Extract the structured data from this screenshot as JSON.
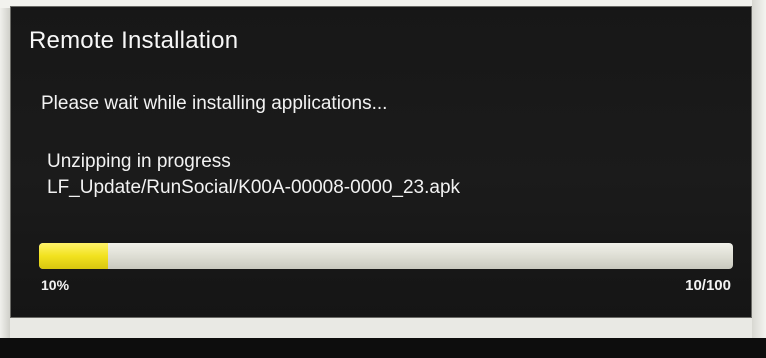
{
  "dialog": {
    "title": "Remote Installation",
    "message": "Please wait while installing applications...",
    "status": "Unzipping in progress",
    "file": "LF_Update/RunSocial/K00A-00008-0000_23.apk",
    "progress": {
      "percent_label": "10%",
      "count_label": "10/100",
      "fraction": 0.1
    }
  },
  "colors": {
    "background": "#1a1a1a",
    "progress_fill": "#f2e21f",
    "progress_track": "#dcdcd2",
    "text": "#f4f4f4"
  }
}
